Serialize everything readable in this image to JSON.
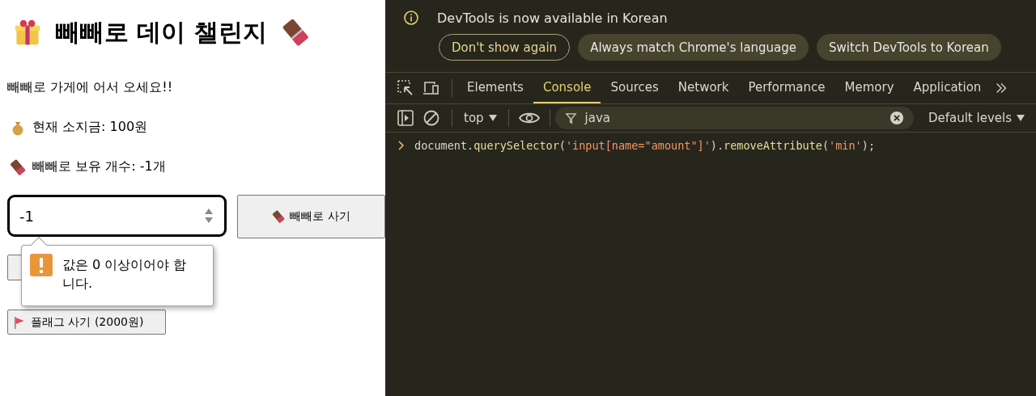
{
  "page": {
    "title": "빼빼로 데이 챌린지",
    "welcome": "빼빼로 가게에 어서 오세요!!",
    "money": "현재 소지금: 100원",
    "stock": "빼빼로 보유 개수: -1개",
    "amount_input": {
      "value": "-1"
    },
    "buy_button": "빼빼로 사기",
    "flag_button": "플래그 사기 (2000원)",
    "validation_tooltip": "값은 0 이상이어야 합니다."
  },
  "devtools": {
    "banner": {
      "message": "DevTools is now available in Korean",
      "buttons": [
        {
          "label": "Don't show again",
          "kind": "outline"
        },
        {
          "label": "Always match Chrome's language",
          "kind": "filled"
        },
        {
          "label": "Switch DevTools to Korean",
          "kind": "filled"
        }
      ]
    },
    "tabs": [
      {
        "label": "Elements",
        "selected": false
      },
      {
        "label": "Console",
        "selected": true
      },
      {
        "label": "Sources",
        "selected": false
      },
      {
        "label": "Network",
        "selected": false
      },
      {
        "label": "Performance",
        "selected": false
      },
      {
        "label": "Memory",
        "selected": false
      },
      {
        "label": "Application",
        "selected": false
      }
    ],
    "context": "top",
    "filter": {
      "value": "java"
    },
    "levels": "Default levels",
    "console_input": [
      {
        "text": "document.",
        "kind": "plain"
      },
      {
        "text": "querySelector",
        "kind": "method"
      },
      {
        "text": "(",
        "kind": "plain"
      },
      {
        "text": "'input[name=\"amount\"]'",
        "kind": "string"
      },
      {
        "text": ").",
        "kind": "plain"
      },
      {
        "text": "removeAttribute",
        "kind": "method"
      },
      {
        "text": "(",
        "kind": "plain"
      },
      {
        "text": "'min'",
        "kind": "string"
      },
      {
        "text": ");",
        "kind": "plain"
      }
    ]
  }
}
